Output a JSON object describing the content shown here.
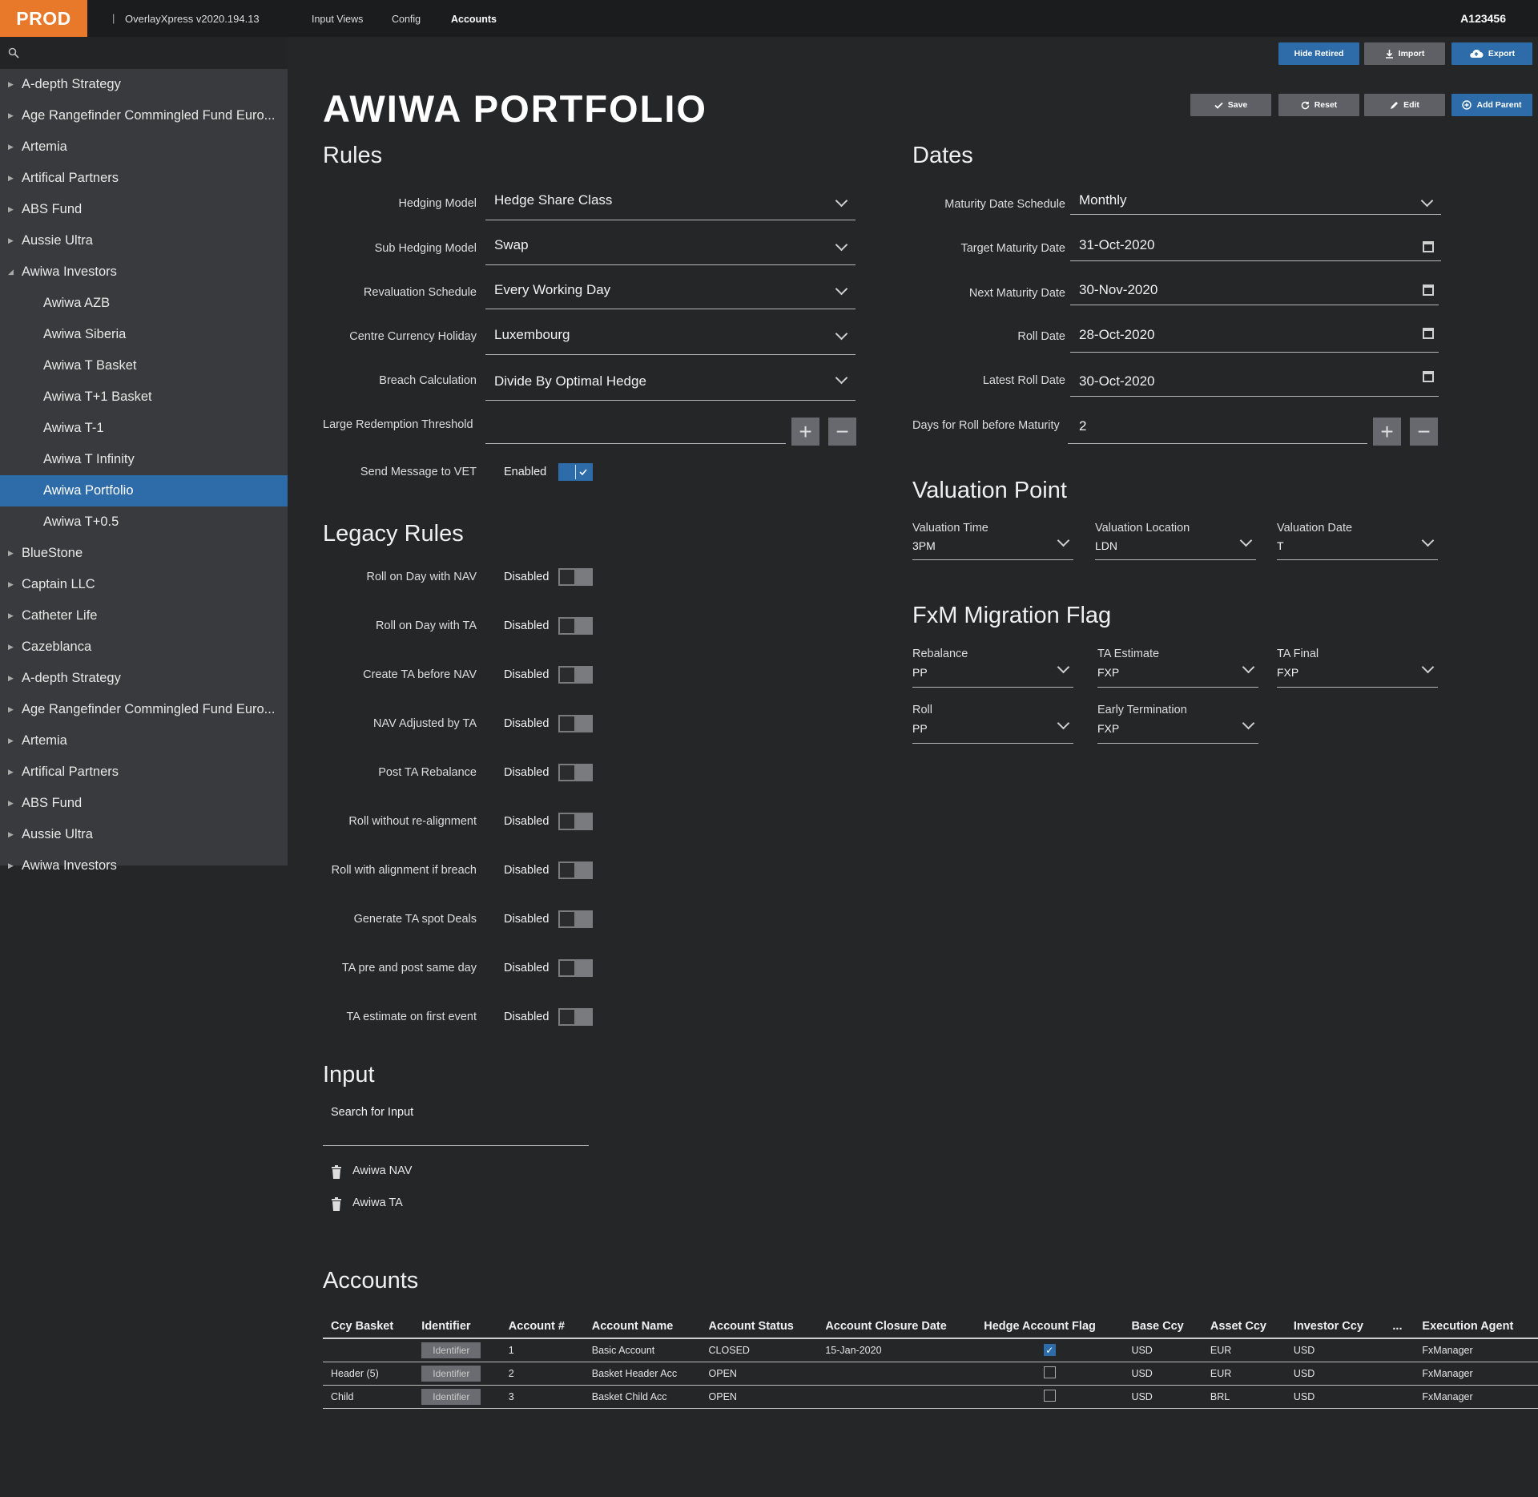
{
  "topbar": {
    "environment": "PROD",
    "app_version": "OverlayXpress v2020.194.13",
    "nav": [
      "Input Views",
      "Config",
      "Accounts"
    ],
    "active_nav": "Accounts",
    "user_id": "A123456"
  },
  "sidebar": {
    "items": [
      {
        "label": "A-depth Strategy",
        "level": 0,
        "expanded": false
      },
      {
        "label": "Age Rangefinder Commingled Fund Euro...",
        "level": 0,
        "expanded": false
      },
      {
        "label": "Artemia",
        "level": 0,
        "expanded": false
      },
      {
        "label": "Artifical Partners",
        "level": 0,
        "expanded": false
      },
      {
        "label": "ABS Fund",
        "level": 0,
        "expanded": false
      },
      {
        "label": "Aussie Ultra",
        "level": 0,
        "expanded": false
      },
      {
        "label": "Awiwa Investors",
        "level": 0,
        "expanded": true
      },
      {
        "label": "Awiwa AZB",
        "level": 1
      },
      {
        "label": "Awiwa Siberia",
        "level": 1
      },
      {
        "label": "Awiwa T Basket",
        "level": 1
      },
      {
        "label": "Awiwa T+1 Basket",
        "level": 1
      },
      {
        "label": "Awiwa T-1",
        "level": 1
      },
      {
        "label": "Awiwa T Infinity",
        "level": 1
      },
      {
        "label": "Awiwa Portfolio",
        "level": 1,
        "selected": true
      },
      {
        "label": "Awiwa T+0.5",
        "level": 1
      },
      {
        "label": "BlueStone",
        "level": 0,
        "expanded": false
      },
      {
        "label": "Captain LLC",
        "level": 0,
        "expanded": false
      },
      {
        "label": "Catheter Life",
        "level": 0,
        "expanded": false
      },
      {
        "label": "Cazeblanca",
        "level": 0,
        "expanded": false
      },
      {
        "label": "A-depth Strategy",
        "level": 0,
        "expanded": false
      },
      {
        "label": "Age Rangefinder Commingled Fund Euro...",
        "level": 0,
        "expanded": false
      },
      {
        "label": "Artemia",
        "level": 0,
        "expanded": false
      },
      {
        "label": "Artifical Partners",
        "level": 0,
        "expanded": false
      },
      {
        "label": "ABS Fund",
        "level": 0,
        "expanded": false
      },
      {
        "label": "Aussie Ultra",
        "level": 0,
        "expanded": false
      },
      {
        "label": "Awiwa Investors",
        "level": 0,
        "expanded": false
      }
    ]
  },
  "toolbar": {
    "hide_retired": "Hide Retired",
    "import": "Import",
    "export": "Export",
    "save": "Save",
    "reset": "Reset",
    "edit": "Edit",
    "add_parent": "Add Parent"
  },
  "page_title": "AWIWA PORTFOLIO",
  "rules": {
    "title": "Rules",
    "hedging_model": {
      "label": "Hedging Model",
      "value": "Hedge Share Class"
    },
    "sub_hedging_model": {
      "label": "Sub Hedging Model",
      "value": "Swap"
    },
    "revaluation_schedule": {
      "label": "Revaluation Schedule",
      "value": "Every Working Day"
    },
    "centre_currency_holiday": {
      "label": "Centre Currency Holiday",
      "value": "Luxembourg"
    },
    "breach_calculation": {
      "label": "Breach Calculation",
      "value": "Divide By Optimal Hedge"
    },
    "large_redemption_threshold": {
      "label": "Large Redemption Threshold",
      "value": ""
    },
    "send_message": {
      "label": "Send Message to VET",
      "state": "Enabled",
      "on": true
    }
  },
  "dates": {
    "title": "Dates",
    "maturity_date_schedule": {
      "label": "Maturity Date Schedule",
      "value": "Monthly"
    },
    "target_maturity_date": {
      "label": "Target Maturity Date",
      "value": "31-Oct-2020"
    },
    "next_maturity_date": {
      "label": "Next Maturity Date",
      "value": "30-Nov-2020"
    },
    "roll_date": {
      "label": "Roll Date",
      "value": "28-Oct-2020"
    },
    "latest_roll_date": {
      "label": "Latest Roll Date",
      "value": "30-Oct-2020"
    },
    "days_for_roll": {
      "label": "Days for Roll before Maturity",
      "value": "2"
    }
  },
  "valuation_point": {
    "title": "Valuation Point",
    "time": {
      "label": "Valuation Time",
      "value": "3PM"
    },
    "location": {
      "label": "Valuation Location",
      "value": "LDN"
    },
    "date": {
      "label": "Valuation Date",
      "value": "T"
    }
  },
  "fxm": {
    "title": "FxM Migration Flag",
    "rebalance": {
      "label": "Rebalance",
      "value": "PP"
    },
    "ta_estimate": {
      "label": "TA Estimate",
      "value": "FXP"
    },
    "ta_final": {
      "label": "TA Final",
      "value": "FXP"
    },
    "roll": {
      "label": "Roll",
      "value": "PP"
    },
    "early_termination": {
      "label": "Early Termination",
      "value": "FXP"
    }
  },
  "legacy_rules": {
    "title": "Legacy Rules",
    "items": [
      {
        "label": "Roll on Day with NAV",
        "state": "Disabled"
      },
      {
        "label": "Roll on Day with TA",
        "state": "Disabled"
      },
      {
        "label": "Create TA before NAV",
        "state": "Disabled"
      },
      {
        "label": "NAV Adjusted by TA",
        "state": "Disabled"
      },
      {
        "label": "Post TA Rebalance",
        "state": "Disabled"
      },
      {
        "label": "Roll without re-alignment",
        "state": "Disabled"
      },
      {
        "label": "Roll with alignment if breach",
        "state": "Disabled"
      },
      {
        "label": "Generate TA spot Deals",
        "state": "Disabled"
      },
      {
        "label": "TA pre and post same day",
        "state": "Disabled"
      },
      {
        "label": "TA estimate on first event",
        "state": "Disabled"
      }
    ]
  },
  "input": {
    "title": "Input",
    "search_placeholder": "Search for Input",
    "items": [
      "Awiwa NAV",
      "Awiwa TA"
    ]
  },
  "accounts": {
    "title": "Accounts",
    "columns": [
      "Ccy Basket",
      "Identifier",
      "Account #",
      "Account Name",
      "Account Status",
      "Account Closure Date",
      "Hedge Account Flag",
      "Base Ccy",
      "Asset Ccy",
      "Investor Ccy",
      "...",
      "Execution Agent"
    ],
    "rows": [
      {
        "ccy_basket": "",
        "identifier": "Identifier",
        "account_no": "1",
        "account_name": "Basic Account",
        "status": "CLOSED",
        "closure_date": "15-Jan-2020",
        "hedge_flag": true,
        "base_ccy": "USD",
        "asset_ccy": "EUR",
        "investor_ccy": "USD",
        "more": "",
        "execution_agent": "FxManager"
      },
      {
        "ccy_basket": "Header (5)",
        "identifier": "Identifier",
        "account_no": "2",
        "account_name": "Basket Header Acc",
        "status": "OPEN",
        "closure_date": "",
        "hedge_flag": false,
        "base_ccy": "USD",
        "asset_ccy": "EUR",
        "investor_ccy": "USD",
        "more": "",
        "execution_agent": "FxManager"
      },
      {
        "ccy_basket": "Child",
        "identifier": "Identifier",
        "account_no": "3",
        "account_name": "Basket Child Acc",
        "status": "OPEN",
        "closure_date": "",
        "hedge_flag": false,
        "base_ccy": "USD",
        "asset_ccy": "BRL",
        "investor_ccy": "USD",
        "more": "",
        "execution_agent": "FxManager"
      }
    ]
  },
  "colors": {
    "accent": "#2d6ca8",
    "env_badge": "#e8782a",
    "background": "#252628",
    "sidebar": "#393a3d"
  }
}
